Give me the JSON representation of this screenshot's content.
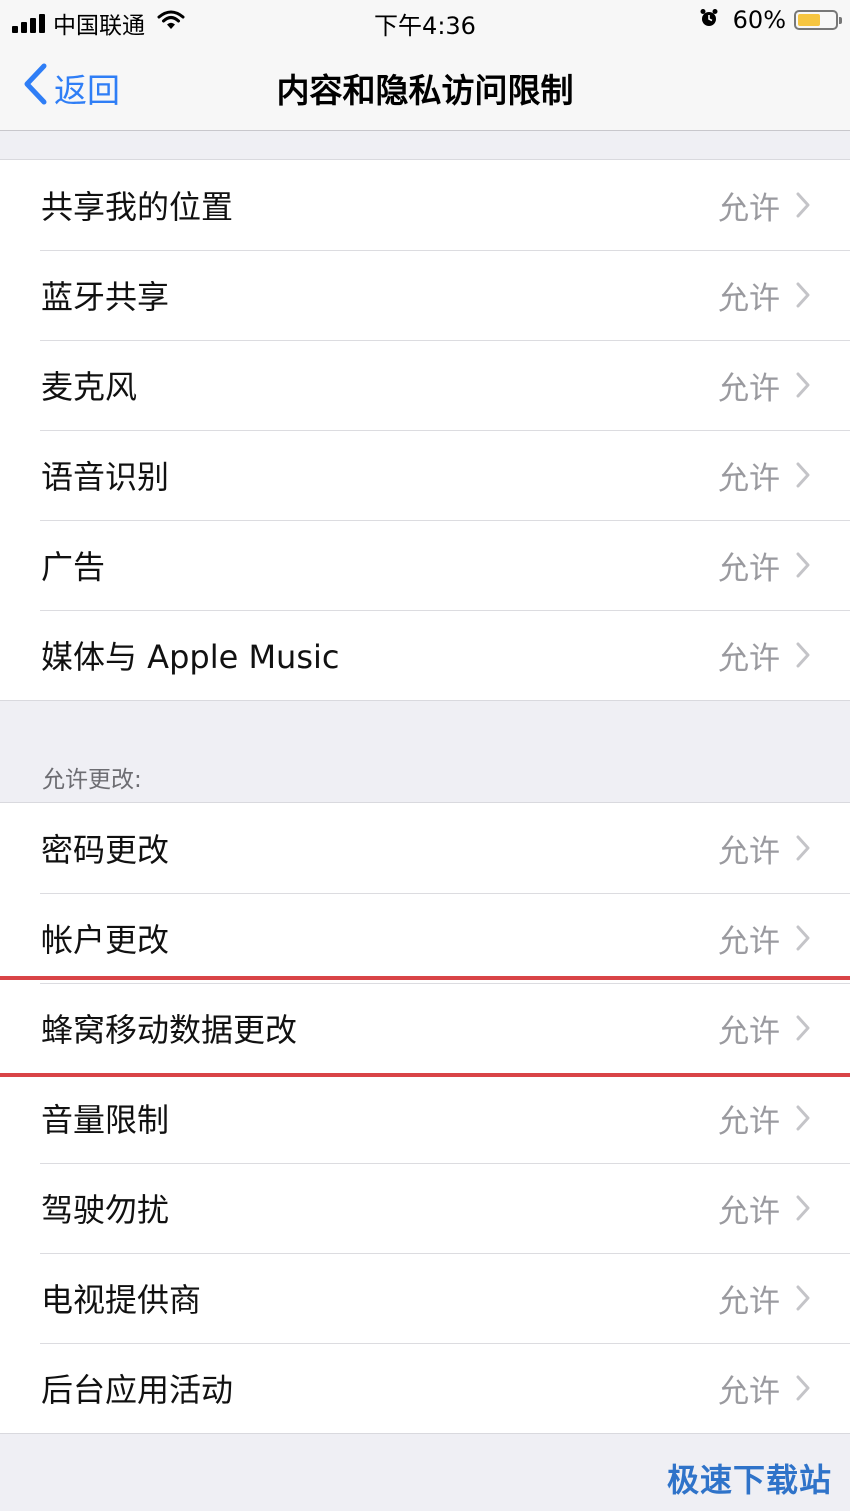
{
  "status_bar": {
    "carrier": "中国联通",
    "time": "下午4:36",
    "battery_percent_text": "60%",
    "battery_level": 0.6,
    "icons": [
      "signal-icon",
      "wifi-icon",
      "alarm-icon",
      "battery-icon"
    ]
  },
  "nav": {
    "back_label": "返回",
    "title": "内容和隐私访问限制",
    "accent_color": "#2f7ef6"
  },
  "group1": {
    "rows": [
      {
        "label": "共享我的位置",
        "value": "允许"
      },
      {
        "label": "蓝牙共享",
        "value": "允许"
      },
      {
        "label": "麦克风",
        "value": "允许"
      },
      {
        "label": "语音识别",
        "value": "允许"
      },
      {
        "label": "广告",
        "value": "允许"
      },
      {
        "label": "媒体与 Apple Music",
        "value": "允许"
      }
    ]
  },
  "section2_header": "允许更改:",
  "group2": {
    "rows": [
      {
        "label": "密码更改",
        "value": "允许"
      },
      {
        "label": "帐户更改",
        "value": "允许"
      },
      {
        "label": "蜂窝移动数据更改",
        "value": "允许"
      },
      {
        "label": "音量限制",
        "value": "允许"
      },
      {
        "label": "驾驶勿扰",
        "value": "允许"
      },
      {
        "label": "电视提供商",
        "value": "允许"
      },
      {
        "label": "后台应用活动",
        "value": "允许"
      }
    ]
  },
  "highlight_color": "#d94447",
  "watermark": "极速下载站"
}
